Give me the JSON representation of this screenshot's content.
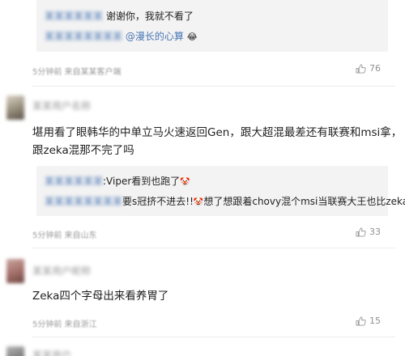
{
  "comment0": {
    "reply1_text": "谢谢你，我就不看了",
    "reply2_user": "@漫长的心算",
    "reply2_emoji": "😂",
    "meta": "5分钟前  来自某某客户端",
    "likes": "76"
  },
  "comment1": {
    "username": "某某用户名称",
    "text_line1": "堪用看了眼韩华的中单立马火速返回Gen，跟大超混最差还有联赛和msi拿，",
    "text_line2": "跟zeka混那不完了吗",
    "reply1_text": ":Viper看到也跑了",
    "reply1_emoji": "🤡",
    "reply2_prefix": "要s冠挤不进去!!",
    "reply2_emoji": "🤡",
    "reply2_text": "想了想跟着chovy混个msi当联赛大王也比zeka强",
    "meta": "5分钟前  来自山东",
    "likes": "33"
  },
  "comment2": {
    "username": "某某用户昵称",
    "text": "Zeka四个字母出来看养胃了",
    "meta": "5分钟前  来自浙江",
    "likes": "15"
  },
  "comment3": {
    "username": "某某用户"
  },
  "colors": {
    "link": "#4a77b5",
    "quote_bg": "#f3f3f3"
  }
}
